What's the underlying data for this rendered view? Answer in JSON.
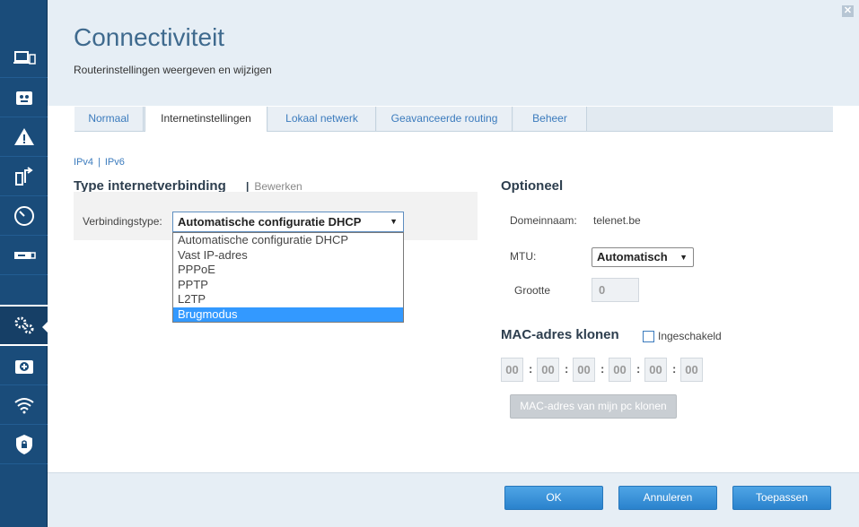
{
  "header": {
    "title": "Connectiviteit",
    "subtitle": "Routerinstellingen weergeven en wijzigen"
  },
  "tabs": [
    {
      "label": "Normaal"
    },
    {
      "label": "Internetinstellingen",
      "active": true
    },
    {
      "label": "Lokaal netwerk"
    },
    {
      "label": "Geavanceerde routing"
    },
    {
      "label": "Beheer"
    }
  ],
  "ip_links": {
    "ipv4": "IPv4",
    "separator": "|",
    "ipv6": "IPv6"
  },
  "connection": {
    "section_title": "Type internetverbinding",
    "edit_separator": "|",
    "edit_label": "Bewerken",
    "type_label": "Verbindingstype:",
    "selected_value": "Automatische configuratie DHCP",
    "options": [
      "Automatische configuratie DHCP",
      "Vast IP-adres",
      "PPPoE",
      "PPTP",
      "L2TP",
      "Brugmodus"
    ],
    "highlighted_option": "Brugmodus"
  },
  "optional": {
    "section_title": "Optioneel",
    "domain_label": "Domeinnaam:",
    "domain_value": "telenet.be",
    "mtu_label": "MTU:",
    "mtu_value": "Automatisch",
    "size_label": "Grootte",
    "size_value": "0"
  },
  "mac_clone": {
    "section_title": "MAC-adres klonen",
    "enabled_label": "Ingeschakeld",
    "enabled": false,
    "octets": [
      "00",
      "00",
      "00",
      "00",
      "00",
      "00"
    ],
    "separator": ":",
    "clone_button": "MAC-adres van mijn pc klonen"
  },
  "footer": {
    "ok": "OK",
    "cancel": "Annuleren",
    "apply": "Toepassen"
  },
  "close_glyph": "✕",
  "dropdown_arrow": "▼",
  "icons": [
    "devices-icon",
    "parental-controls-icon",
    "guest-access-icon",
    "media-prioritization-icon",
    "speed-test-icon",
    "usb-storage-icon",
    "connectivity-settings-icon",
    "troubleshooting-icon",
    "wireless-icon",
    "security-icon"
  ],
  "colors": {
    "sidebar": "#1a4c7a",
    "accent": "#3b7bbd",
    "selection": "#3399ff",
    "button": "#2a82cc"
  }
}
